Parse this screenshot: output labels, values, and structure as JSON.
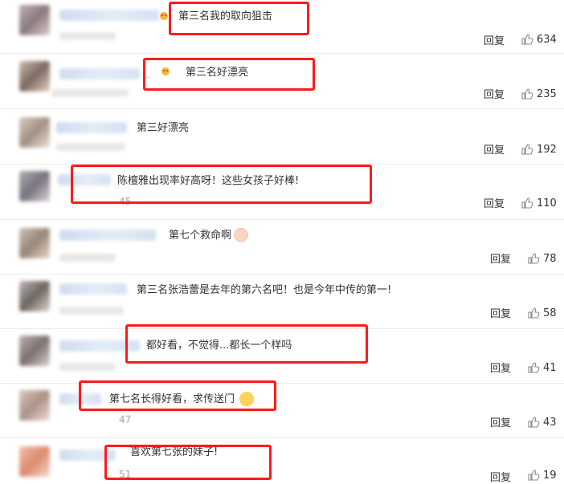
{
  "comments": [
    {
      "text": "第三名我的取向狙击",
      "reply": "回复",
      "likes": "634",
      "badge": "crown"
    },
    {
      "text": "第三名好漂亮",
      "prefix": "_",
      "reply": "回复",
      "likes": "235",
      "badge": "crown"
    },
    {
      "text": "第三好漂亮",
      "reply": "回复",
      "likes": "192"
    },
    {
      "text": "陈檀雅出现率好高呀！这些女孩子好棒!",
      "count": "45",
      "reply": "回复",
      "likes": "110"
    },
    {
      "text": "第七个救命啊",
      "reply": "回复",
      "likes": "78",
      "emoji": "cat-face-icon"
    },
    {
      "text": "第三名张浩蕾是去年的第六名吧！也是今年中传的第一!",
      "reply": "回复",
      "likes": "58"
    },
    {
      "text": "都好看，不觉得...都长一个样吗",
      "reply": "回复",
      "likes": "41"
    },
    {
      "text": "第七名长得好看，求传送门",
      "count": "47",
      "reply": "回复",
      "likes": "43",
      "emoji": "unamused-face-icon"
    },
    {
      "text": "喜欢第七张的妹子!",
      "count": "51",
      "reply": "回复",
      "likes": "19"
    }
  ],
  "colors": {
    "highlight_box": "#ff1a1a",
    "username_blur": "#cfdcf0"
  }
}
